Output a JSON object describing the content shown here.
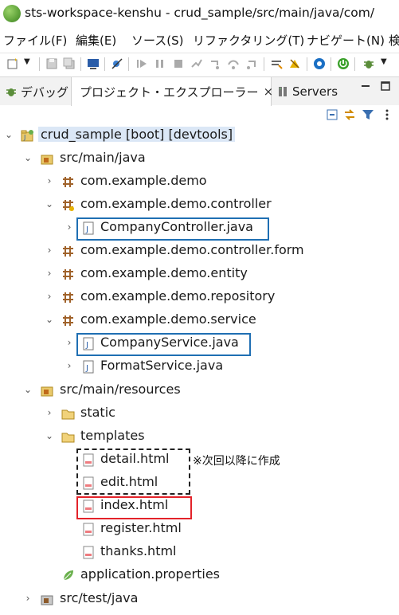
{
  "window": {
    "title": "sts-workspace-kenshu - crud_sample/src/main/java/com/"
  },
  "menubar": {
    "items": [
      "ファイル(F)",
      "編集(E)",
      "ソース(S)",
      "リファクタリング(T)",
      "ナビゲート(N)",
      "検"
    ]
  },
  "tabs": {
    "debug": "デバッグ",
    "explorer": "プロジェクト・エクスプローラー",
    "explorer_close": "×",
    "servers": "Servers"
  },
  "tree": {
    "root": "crud_sample [boot] [devtools]",
    "src_main_java": "src/main/java",
    "pkg_demo": "com.example.demo",
    "pkg_controller": "com.example.demo.controller",
    "file_company_controller": "CompanyController.java",
    "pkg_controller_form": "com.example.demo.controller.form",
    "pkg_entity": "com.example.demo.entity",
    "pkg_repository": "com.example.demo.repository",
    "pkg_service": "com.example.demo.service",
    "file_company_service": "CompanyService.java",
    "file_format_service": "FormatService.java",
    "src_main_resources": "src/main/resources",
    "folder_static": "static",
    "folder_templates": "templates",
    "file_detail": "detail.html",
    "file_edit": "edit.html",
    "file_index": "index.html",
    "file_register": "register.html",
    "file_thanks": "thanks.html",
    "file_app_props": "application.properties",
    "src_test_java": "src/test/java"
  },
  "annotation": {
    "note": "※次回以降に作成"
  },
  "colors": {
    "highlight_blue": "#1f6fb3",
    "highlight_red": "#e3232a",
    "selection": "#dbe7f6"
  }
}
